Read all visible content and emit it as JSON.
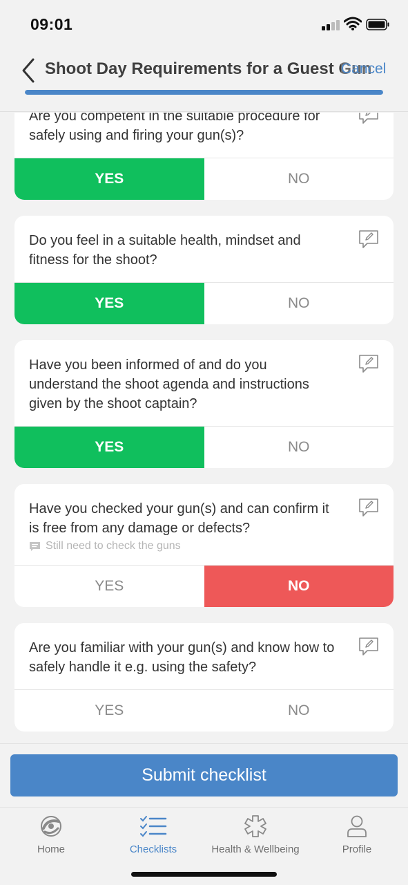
{
  "status_bar": {
    "time": "09:01"
  },
  "header": {
    "title": "Shoot Day Requirements for a Guest Gun",
    "cancel_label": "Cancel",
    "progress": 1.0
  },
  "questions": [
    {
      "text": "Are you competent in the suitable procedure for safely using and firing your gun(s)?",
      "answer": "yes",
      "comment": ""
    },
    {
      "text": "Do you feel in a suitable health, mindset and fitness for the shoot?",
      "answer": "yes",
      "comment": ""
    },
    {
      "text": "Have you been informed of and do you understand the shoot agenda and instructions given by the shoot captain?",
      "answer": "yes",
      "comment": ""
    },
    {
      "text": "Have you checked your gun(s) and can confirm it is free from any damage or defects?",
      "answer": "no",
      "comment": "Still need to check the guns"
    },
    {
      "text": "Are you familiar with your gun(s) and know how to safely handle it e.g. using the safety?",
      "answer": "",
      "comment": ""
    }
  ],
  "answer_labels": {
    "yes": "YES",
    "no": "NO"
  },
  "submit_label": "Submit checklist",
  "tabs": [
    {
      "label": "Home",
      "icon": "home-logo-icon"
    },
    {
      "label": "Checklists",
      "icon": "checklist-icon",
      "active": true
    },
    {
      "label": "Health & Wellbeing",
      "icon": "wellbeing-icon"
    },
    {
      "label": "Profile",
      "icon": "profile-icon"
    }
  ],
  "colors": {
    "accent": "#4a86c8",
    "yes": "#10bf5d",
    "no": "#ee5858"
  }
}
